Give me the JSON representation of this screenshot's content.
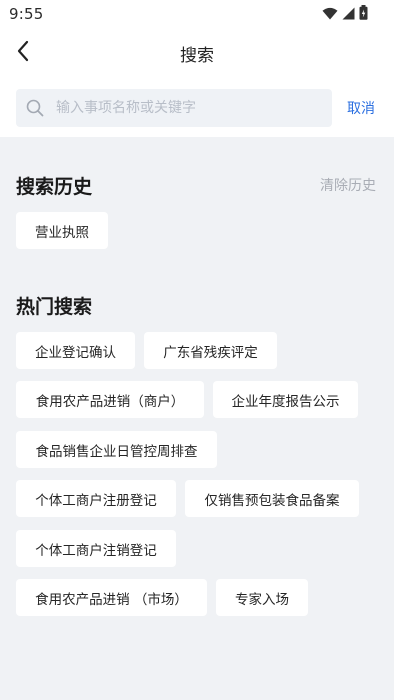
{
  "status_bar": {
    "time": "9:55",
    "icons": [
      "wifi-icon",
      "signal-icon",
      "battery-icon"
    ]
  },
  "nav": {
    "back_icon": "chevron-left-icon",
    "title": "搜索"
  },
  "search": {
    "placeholder": "输入事项名称或关键字",
    "value": "",
    "cancel_label": "取消"
  },
  "history": {
    "title": "搜索历史",
    "clear_label": "清除历史",
    "items": [
      "营业执照"
    ]
  },
  "hot": {
    "title": "热门搜索",
    "items": [
      "企业登记确认",
      "广东省残疾评定",
      "食用农产品进销（商户）",
      "企业年度报告公示",
      "食品销售企业日管控周排查",
      "个体工商户注册登记",
      "仅销售预包装食品备案",
      "个体工商户注销登记",
      "食用农产品进销 （市场）",
      "专家入场"
    ]
  },
  "colors": {
    "accent": "#2b6fe0",
    "page_background": "#f0f2f5",
    "chip_background": "#ffffff",
    "muted_text": "#a9adb5"
  }
}
